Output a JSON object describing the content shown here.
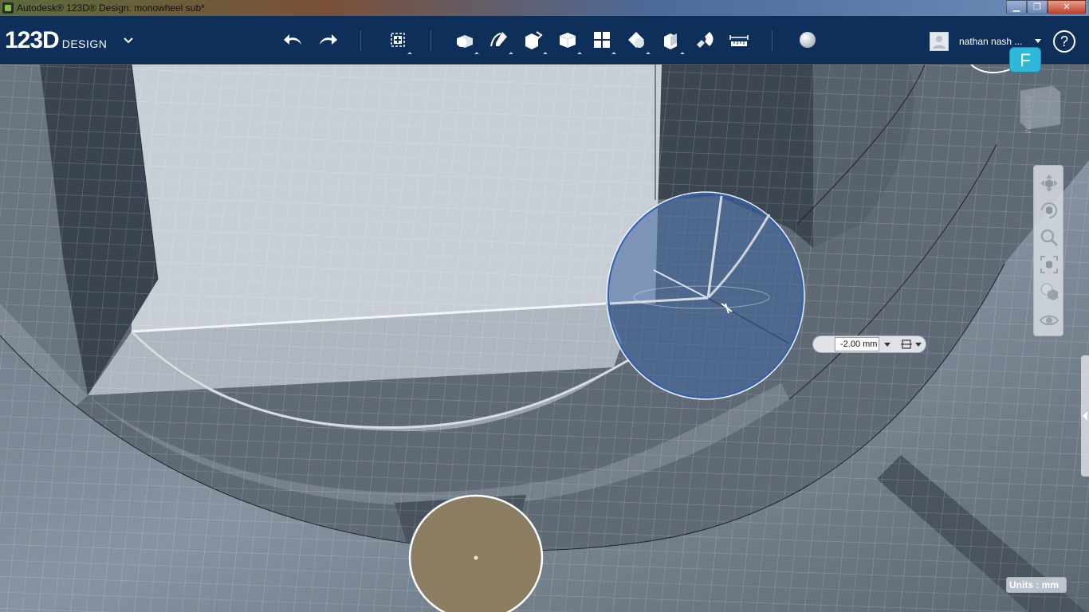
{
  "window": {
    "title": "Autodesk® 123D® Design: monowheel sub*",
    "controls": {
      "minimize": "▁",
      "maximize": "❐",
      "close": "✕"
    }
  },
  "app": {
    "logo_main": "123D",
    "logo_sub": "DESIGN"
  },
  "toolbar": {
    "items": [
      {
        "name": "undo",
        "icon": "undo-arrow"
      },
      {
        "name": "redo",
        "icon": "redo-arrow"
      },
      {
        "name": "transform",
        "icon": "transform-move",
        "has_menu": true
      },
      {
        "name": "primitives",
        "icon": "box-sphere",
        "has_menu": true
      },
      {
        "name": "sketch",
        "icon": "pen-curve",
        "has_menu": true
      },
      {
        "name": "construct",
        "icon": "extrude-cube",
        "has_menu": true
      },
      {
        "name": "modify",
        "icon": "solid-cube",
        "has_menu": true
      },
      {
        "name": "pattern",
        "icon": "grid-squares",
        "has_menu": true
      },
      {
        "name": "grouping",
        "icon": "group-shapes",
        "has_menu": true
      },
      {
        "name": "combine",
        "icon": "combine-boxes",
        "has_menu": true
      },
      {
        "name": "snap",
        "icon": "magnet",
        "has_menu": false
      },
      {
        "name": "measure",
        "icon": "ruler",
        "has_menu": false
      },
      {
        "name": "material",
        "icon": "material-sphere",
        "has_menu": false
      }
    ]
  },
  "user": {
    "name": "nathan nash ...",
    "help": "?"
  },
  "badge": {
    "label": "F"
  },
  "viewcube": {
    "face": "BOTTOM"
  },
  "navbar": {
    "items": [
      "pan",
      "orbit",
      "zoom",
      "fit",
      "view-mode",
      "visibility"
    ]
  },
  "dimension": {
    "value": "-2.00 mm"
  },
  "status": {
    "units": "Units : mm"
  },
  "colors": {
    "toolbar": "#0e2f5a",
    "selection": "#3e78c8",
    "sketch_fill": "#8b7d62",
    "accent": "#2fb8d8"
  }
}
